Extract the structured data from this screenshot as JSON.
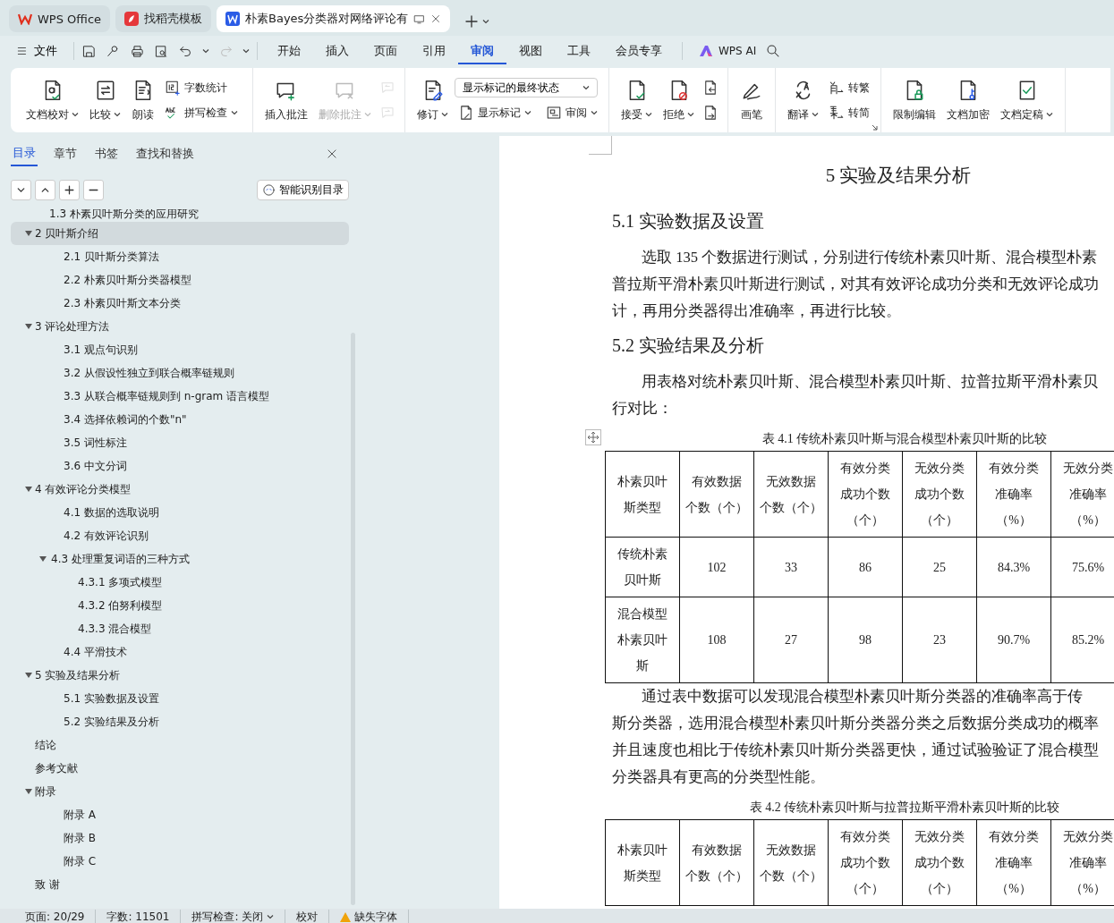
{
  "tabs": [
    {
      "label": "WPS Office",
      "selected": false,
      "kind": "home"
    },
    {
      "label": "找稻壳模板",
      "selected": false,
      "kind": "template"
    },
    {
      "label": "朴素Bayes分类器对网络评论有",
      "selected": true,
      "kind": "document"
    }
  ],
  "menu": {
    "file": "文件",
    "items": [
      {
        "label": "开始",
        "selected": false
      },
      {
        "label": "插入",
        "selected": false
      },
      {
        "label": "页面",
        "selected": false
      },
      {
        "label": "引用",
        "selected": false
      },
      {
        "label": "审阅",
        "selected": true
      },
      {
        "label": "视图",
        "selected": false
      },
      {
        "label": "工具",
        "selected": false
      },
      {
        "label": "会员专享",
        "selected": false
      }
    ],
    "ai": "WPS AI"
  },
  "ribbon": {
    "groups": [
      {
        "tools": [
          {
            "kind": "large",
            "label": "文档校对",
            "dropdown": true,
            "disabled": false
          },
          {
            "kind": "large",
            "label": "比较",
            "dropdown": true,
            "disabled": false
          },
          {
            "kind": "large",
            "label": "朗读",
            "dropdown": false,
            "disabled": false
          },
          {
            "kind": "stack",
            "items": [
              {
                "label": "字数统计",
                "dropdown": false,
                "disabled": false
              },
              {
                "label": "拼写检查",
                "dropdown": true,
                "disabled": false
              }
            ]
          }
        ]
      },
      {
        "tools": [
          {
            "kind": "large",
            "label": "插入批注",
            "dropdown": false,
            "disabled": false
          },
          {
            "kind": "large",
            "label": "删除批注",
            "dropdown": true,
            "disabled": true
          },
          {
            "kind": "icon_stack",
            "items": [
              {
                "disabled": true
              },
              {
                "disabled": true
              }
            ]
          }
        ]
      },
      {
        "tools": [
          {
            "kind": "large",
            "label": "修订",
            "dropdown": true,
            "disabled": false
          },
          {
            "kind": "select_stack",
            "select": "显示标记的最终状态",
            "items": [
              {
                "label": "显示标记",
                "dropdown": true,
                "disabled": false
              },
              {
                "label": "审阅",
                "dropdown": true,
                "disabled": false
              }
            ]
          }
        ]
      },
      {
        "tools": [
          {
            "kind": "large",
            "label": "接受",
            "dropdown": true,
            "disabled": false
          },
          {
            "kind": "large",
            "label": "拒绝",
            "dropdown": true,
            "disabled": false
          },
          {
            "kind": "icon_stack",
            "items": [
              {
                "disabled": false
              },
              {
                "disabled": false
              }
            ]
          }
        ]
      },
      {
        "tools": [
          {
            "kind": "large",
            "label": "画笔",
            "dropdown": false,
            "disabled": false
          }
        ]
      },
      {
        "tools": [
          {
            "kind": "large",
            "label": "翻译",
            "dropdown": true,
            "disabled": false
          },
          {
            "kind": "stack",
            "items": [
              {
                "label": "转繁",
                "dropdown": false,
                "disabled": false
              },
              {
                "label": "转简",
                "dropdown": false,
                "disabled": false
              }
            ]
          },
          {
            "kind": "launcher"
          }
        ]
      },
      {
        "tools": [
          {
            "kind": "large",
            "label": "限制编辑",
            "dropdown": false,
            "disabled": false
          },
          {
            "kind": "large",
            "label": "文档加密",
            "dropdown": false,
            "disabled": false
          },
          {
            "kind": "large",
            "label": "文档定稿",
            "dropdown": true,
            "disabled": false
          }
        ]
      }
    ]
  },
  "nav_panel": {
    "tabs": [
      {
        "label": "目录",
        "selected": true
      },
      {
        "label": "章节",
        "selected": false
      },
      {
        "label": "书签",
        "selected": false
      },
      {
        "label": "查找和替换",
        "selected": false
      }
    ],
    "smart_toc_button": "智能识别目录",
    "partial_top_item": "1.3 朴素贝叶斯分类的应用研究",
    "items": [
      {
        "label": "2  贝叶斯介绍",
        "selected": true,
        "expanded": true,
        "children": [
          {
            "label": "2.1 贝叶斯分类算法",
            "selected": false
          },
          {
            "label": "2.2 朴素贝叶斯分类器模型",
            "selected": false
          },
          {
            "label": "2.3 朴素贝叶斯文本分类",
            "selected": false
          }
        ]
      },
      {
        "label": "3  评论处理方法",
        "selected": false,
        "expanded": true,
        "children": [
          {
            "label": "3.1 观点句识别",
            "selected": false
          },
          {
            "label": "3.2 从假设性独立到联合概率链规则",
            "selected": false
          },
          {
            "label": "3.3 从联合概率链规则到 n-gram 语言模型",
            "selected": false
          },
          {
            "label": "3.4 选择依赖词的个数\"n\"",
            "selected": false
          },
          {
            "label": "3.5 词性标注",
            "selected": false
          },
          {
            "label": "3.6 中文分词",
            "selected": false
          }
        ]
      },
      {
        "label": "4  有效评论分类模型",
        "selected": false,
        "expanded": true,
        "children": [
          {
            "label": "4.1 数据的选取说明",
            "selected": false
          },
          {
            "label": "4.2 有效评论识别",
            "selected": false
          },
          {
            "label": "4.3 处理重复词语的三种方式",
            "selected": false,
            "expanded": true,
            "children": [
              {
                "label": "4.3.1 多项式模型",
                "selected": false
              },
              {
                "label": "4.3.2 伯努利模型",
                "selected": false
              },
              {
                "label": "4.3.3 混合模型",
                "selected": false
              }
            ]
          },
          {
            "label": "4.4 平滑技术",
            "selected": false
          }
        ]
      },
      {
        "label": "5  实验及结果分析",
        "selected": false,
        "expanded": true,
        "children": [
          {
            "label": "5.1 实验数据及设置",
            "selected": false
          },
          {
            "label": "5.2 实验结果及分析",
            "selected": false
          }
        ]
      },
      {
        "label": "结论",
        "selected": false
      },
      {
        "label": "参考文献",
        "selected": false
      },
      {
        "label": "附录",
        "selected": false,
        "expanded": true,
        "children": [
          {
            "label": "附录 A",
            "selected": false
          },
          {
            "label": "附录 B",
            "selected": false
          },
          {
            "label": "附录 C",
            "selected": false
          }
        ]
      },
      {
        "label": "致  谢",
        "selected": false
      }
    ]
  },
  "document": {
    "blocks": [
      {
        "kind": "chapter",
        "text": "5  实验及结果分析"
      },
      {
        "kind": "section",
        "text": "5.1 实验数据及设置"
      },
      {
        "kind": "paragraph",
        "lines": [
          "选取 135 个数据进行测试，分别进行传统朴素贝叶斯、混合模型朴素",
          "普拉斯平滑朴素贝叶斯进行测试，对其有效评论成功分类和无效评论成功",
          "计，再用分类器得出准确率，再进行比较。"
        ]
      },
      {
        "kind": "section",
        "text": "5.2 实验结果及分析"
      },
      {
        "kind": "paragraph",
        "lines": [
          "用表格对统朴素贝叶斯、混合模型朴素贝叶斯、拉普拉斯平滑朴素贝",
          "行对比："
        ]
      },
      {
        "kind": "table",
        "caption": "表 4.1 传统朴素贝叶斯与混合模型朴素贝叶斯的比较",
        "header": [
          [
            "朴素贝叶",
            "斯类型"
          ],
          [
            "有效数据",
            "个数（个）"
          ],
          [
            "无效数据",
            "个数（个）"
          ],
          [
            "有效分类",
            "成功个数",
            "（个）"
          ],
          [
            "无效分类",
            "成功个数",
            "（个）"
          ],
          [
            "有效分类",
            "准确率",
            "（%）"
          ],
          [
            "无效分类",
            "准确率",
            "（%）"
          ]
        ],
        "rows": [
          [
            [
              "传统朴素",
              "贝叶斯"
            ],
            [
              "102"
            ],
            [
              "33"
            ],
            [
              "86"
            ],
            [
              "25"
            ],
            [
              "84.3%"
            ],
            [
              "75.6%"
            ]
          ],
          [
            [
              "混合模型",
              "朴素贝叶",
              "斯"
            ],
            [
              "108"
            ],
            [
              "27"
            ],
            [
              "98"
            ],
            [
              "23"
            ],
            [
              "90.7%"
            ],
            [
              "85.2%"
            ]
          ]
        ]
      },
      {
        "kind": "paragraph",
        "lines": [
          "通过表中数据可以发现混合模型朴素贝叶斯分类器的准确率高于传",
          "斯分类器，选用混合模型朴素贝叶斯分类器分类之后数据分类成功的概率",
          "并且速度也相比于传统朴素贝叶斯分类器更快，通过试验验证了混合模型",
          "分类器具有更高的分类型性能。"
        ]
      },
      {
        "kind": "table",
        "caption": "表 4.2 传统朴素贝叶斯与拉普拉斯平滑朴素贝叶斯的比较",
        "header": [
          [
            "朴素贝叶",
            "斯类型"
          ],
          [
            "有效数据",
            "个数（个）"
          ],
          [
            "无效数据",
            "个数（个）"
          ],
          [
            "有效分类",
            "成功个数",
            "（个）"
          ],
          [
            "无效分类",
            "成功个数",
            "（个）"
          ],
          [
            "有效分类",
            "准确率",
            "（%）"
          ],
          [
            "无效分类",
            "准确率",
            "（%）"
          ]
        ]
      }
    ]
  },
  "status_bar": {
    "items": [
      {
        "label": "页面: 20/29",
        "dropdown": false,
        "kind": "text"
      },
      {
        "label": "字数: 11501",
        "dropdown": false,
        "kind": "text"
      },
      {
        "label": "拼写检查: 关闭",
        "dropdown": true,
        "kind": "text"
      },
      {
        "label": "校对",
        "dropdown": false,
        "kind": "text"
      },
      {
        "label": "缺失字体",
        "dropdown": false,
        "kind": "warning"
      }
    ]
  }
}
